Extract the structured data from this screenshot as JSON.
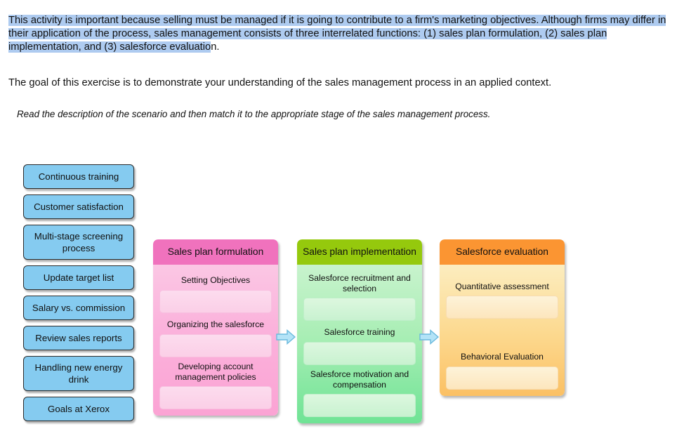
{
  "intro": {
    "highlighted_paragraph": "This activity is important because selling must be managed if it is going to contribute to a firm's marketing objectives. Although firms may differ in their application of the process, sales management consists of three interrelated functions: (1) sales plan formulation, (2) sales plan implementation, and (3) salesforce evaluatio",
    "highlight_tail": "n.",
    "goal_paragraph": "The goal of this exercise is to demonstrate your understanding of the sales management process in an applied context.",
    "highlight_color": "#aecbf0"
  },
  "instruction": "Read the description of the scenario and then match it to the appropriate stage of the sales management process.",
  "answer_tiles": [
    {
      "label": "Continuous training"
    },
    {
      "label": "Customer satisfaction"
    },
    {
      "label": "Multi-stage screening process"
    },
    {
      "label": "Update target list"
    },
    {
      "label": "Salary vs. commission"
    },
    {
      "label": "Review sales reports"
    },
    {
      "label": "Handling new energy drink"
    },
    {
      "label": "Goals at Xerox"
    }
  ],
  "stages": [
    {
      "id": "formulation",
      "title": "Sales plan formulation",
      "header_color": "#f072bd",
      "slots": [
        {
          "label": "Setting Objectives",
          "value": ""
        },
        {
          "label": "Organizing the salesforce",
          "value": ""
        },
        {
          "label": "Developing account management policies",
          "value": ""
        }
      ]
    },
    {
      "id": "implementation",
      "title": "Sales plan implementation",
      "header_color": "#95c90d",
      "slots": [
        {
          "label": "Salesforce recruitment and selection",
          "value": ""
        },
        {
          "label": "Salesforce training",
          "value": ""
        },
        {
          "label": "Salesforce motivation and compensation",
          "value": ""
        }
      ]
    },
    {
      "id": "evaluation",
      "title": "Salesforce evaluation",
      "header_color": "#fb9532",
      "slots": [
        {
          "label": "Quantitative assessment",
          "value": ""
        },
        {
          "label": "Behavioral Evaluation",
          "value": ""
        }
      ]
    }
  ],
  "arrows": {
    "fill_color": "#b3e3f7",
    "stroke_color": "#6ab9dd",
    "icon": "right-arrow-icon"
  }
}
